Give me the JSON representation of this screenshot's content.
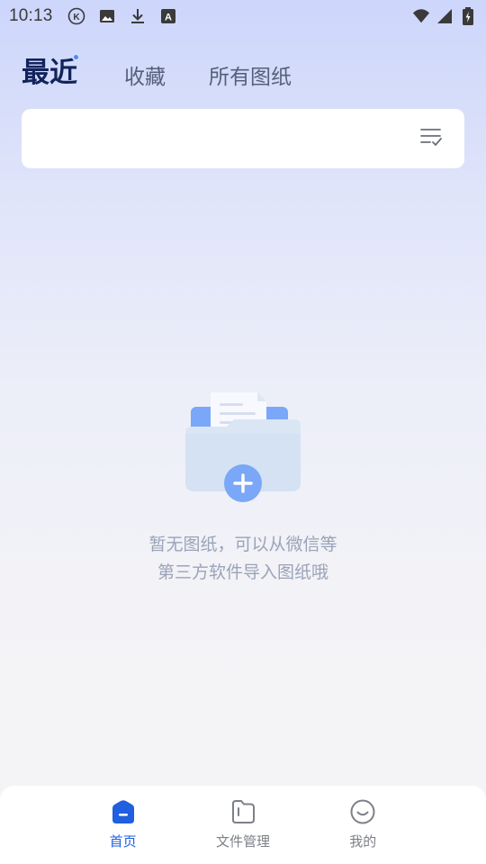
{
  "status_bar": {
    "time": "10:13",
    "left_icons": [
      "k-badge-icon",
      "image-icon",
      "download-icon",
      "a-badge-icon"
    ],
    "right_icons": [
      "wifi-icon",
      "signal-icon",
      "battery-icon"
    ]
  },
  "tabs": [
    {
      "label": "最近",
      "active": true
    },
    {
      "label": "收藏",
      "active": false
    },
    {
      "label": "所有图纸",
      "active": false
    }
  ],
  "filter": {
    "icon": "filter-check-icon"
  },
  "empty_state": {
    "line1": "暂无图纸，可以从微信等",
    "line2": "第三方软件导入图纸哦",
    "icon": "folder-add-icon"
  },
  "bottom_nav": [
    {
      "label": "首页",
      "icon": "home-icon",
      "active": true
    },
    {
      "label": "文件管理",
      "icon": "folder-icon",
      "active": false
    },
    {
      "label": "我的",
      "icon": "profile-icon",
      "active": false
    }
  ],
  "colors": {
    "accent": "#1f5fe0",
    "title_active": "#13245c",
    "tab_inactive": "#56607a",
    "empty_text": "#9aa3b8"
  }
}
